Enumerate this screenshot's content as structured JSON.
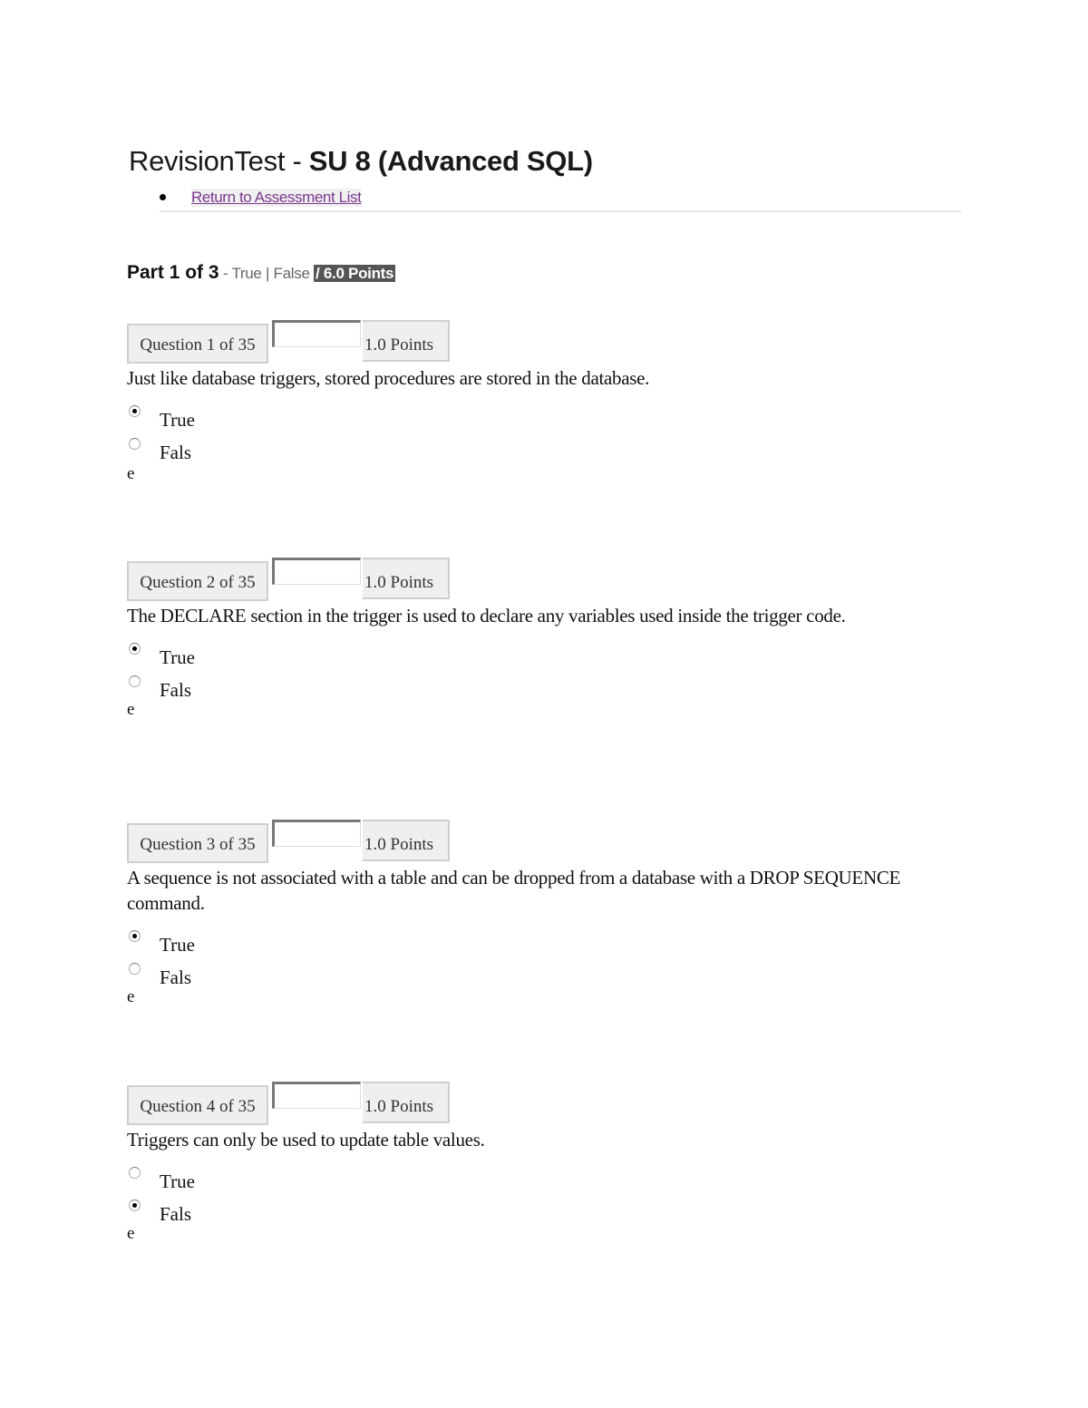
{
  "page": {
    "title_light": "RevisionTest - ",
    "title_bold": "SU 8 (Advanced SQL)",
    "return_link": "Return to Assessment List"
  },
  "part": {
    "title": "Part 1 of 3",
    "type": " - True | False ",
    "points": "/ 6.0 Points"
  },
  "questions": [
    {
      "number_label": "Question 1 of 35",
      "points_label": "1.0 Points",
      "text": "Just like database triggers, stored procedures are stored in the database.",
      "options": [
        "True",
        "Fals"
      ],
      "option_tail": "e",
      "selected": "True"
    },
    {
      "number_label": "Question 2 of 35",
      "points_label": "1.0 Points",
      "text": "The DECLARE section in the trigger is used to declare any variables used inside the trigger code.",
      "options": [
        "True",
        "Fals"
      ],
      "option_tail": "e",
      "selected": "True"
    },
    {
      "number_label": "Question 3 of 35",
      "points_label": "1.0 Points",
      "text": "A sequence is not associated with a table and can be dropped from a database with a DROP SEQUENCE command.",
      "options": [
        "True",
        "Fals"
      ],
      "option_tail": "e",
      "selected": "True"
    },
    {
      "number_label": "Question 4 of 35",
      "points_label": "1.0 Points",
      "text": "Triggers can only be used to update table values.",
      "options": [
        "True",
        "Fals"
      ],
      "option_tail": "e",
      "selected": "Fals"
    }
  ],
  "colors": {
    "link": "#7b3a8f",
    "points_badge_bg": "#555555"
  }
}
